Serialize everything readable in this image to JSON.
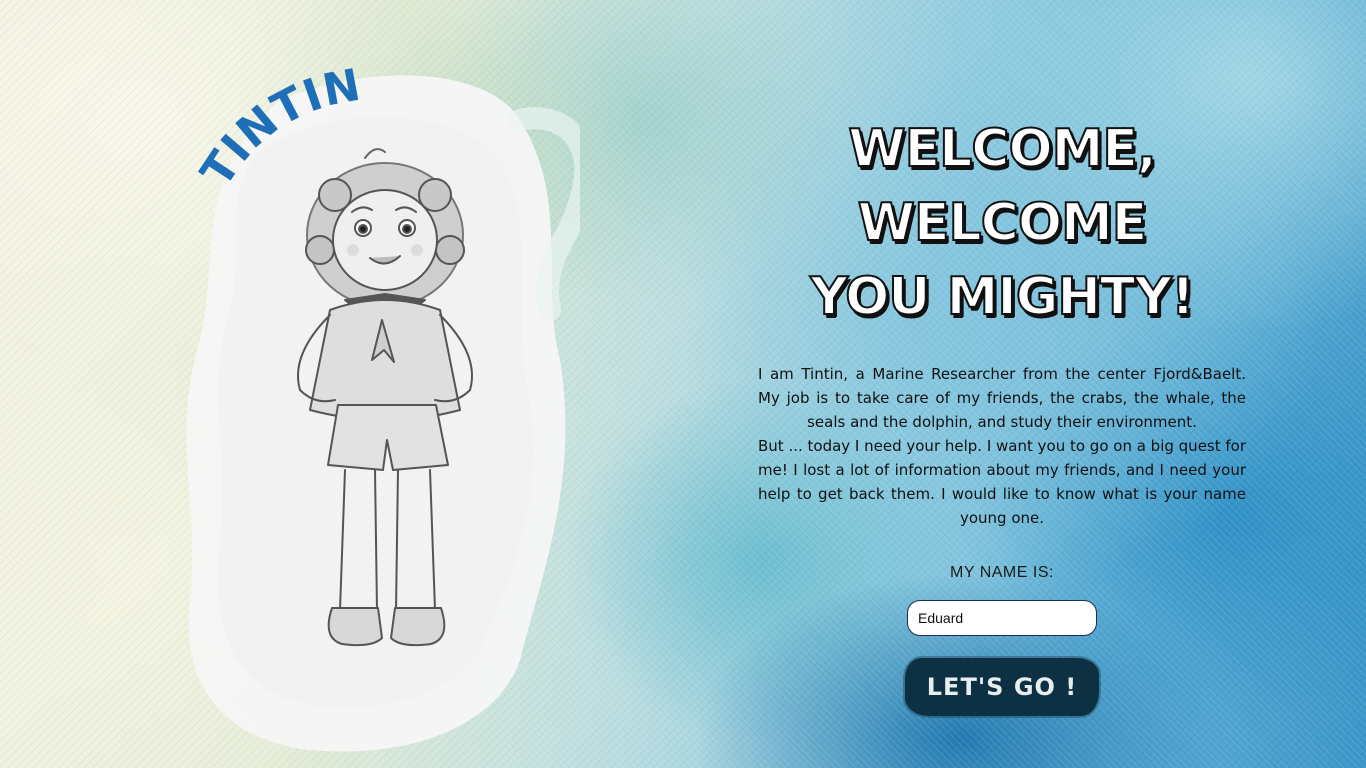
{
  "character": {
    "name_label": "TINTIN"
  },
  "welcome": {
    "heading_line1": "WELCOME, WELCOME",
    "heading_line2": "YOU MIGHTY!"
  },
  "intro": {
    "paragraph1": "I am Tintin, a Marine Researcher from the center Fjord&Baelt. My job is to take care of my friends, the crabs, the whale, the seals and the dolphin, and study their environment.",
    "paragraph2": "But ... today I need your help. I want you to go on a big quest for me! I lost a lot of information about my friends, and I need your help to get back them. I would like to know what is your name young one."
  },
  "form": {
    "name_label": "MY NAME IS:",
    "name_value": "Eduard",
    "submit_label": "LET'S GO !"
  },
  "colors": {
    "title_blue": "#1f6fb8",
    "button_bg": "#0d3142",
    "input_border": "#1b2d4a"
  }
}
